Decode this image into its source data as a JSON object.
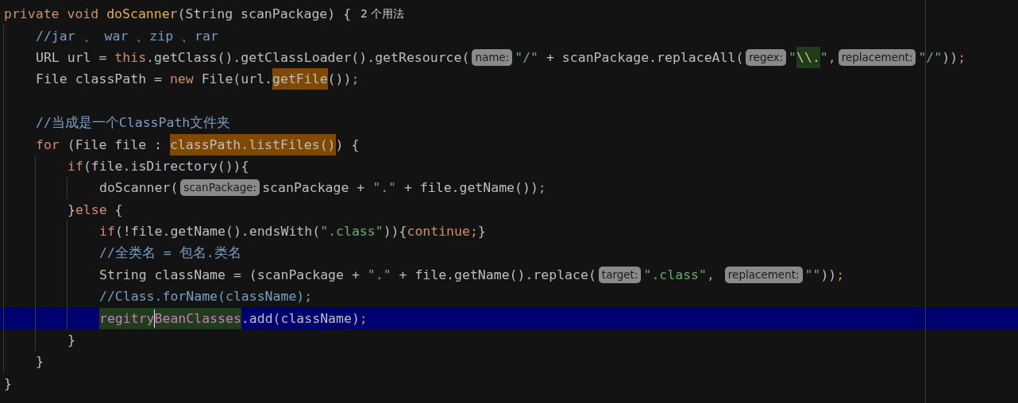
{
  "editor": {
    "lines": [
      {
        "current": false,
        "tokens": [
          {
            "kind": "keyword",
            "text": "private void "
          },
          {
            "kind": "declaration",
            "text": "doScanner"
          },
          {
            "kind": "plain",
            "text": "(String scanPackage) {"
          },
          {
            "kind": "usages",
            "text": "2 个用法"
          }
        ],
        "children": [
          {
            "current": false,
            "tokens": [
              {
                "kind": "comment",
                "text": "//jar 、 war 、zip 、rar"
              }
            ]
          },
          {
            "current": false,
            "tokens": [
              {
                "kind": "plain",
                "text": "URL url = "
              },
              {
                "kind": "keyword",
                "text": "this"
              },
              {
                "kind": "plain",
                "text": ".getClass().getClassLoader().getResource("
              },
              {
                "kind": "hint",
                "text": "name:"
              },
              {
                "kind": "string",
                "text": "\"/\""
              },
              {
                "kind": "plain",
                "text": " + scanPackage.replaceAll("
              },
              {
                "kind": "hint",
                "text": "regex:"
              },
              {
                "kind": "string",
                "text": "\""
              },
              {
                "kind": "escape",
                "text": "\\\\.",
                "write_highlight": true
              },
              {
                "kind": "string",
                "text": "\""
              },
              {
                "kind": "keyword",
                "text": ","
              },
              {
                "kind": "hint",
                "text": "replacement:"
              },
              {
                "kind": "string",
                "text": "\"/\""
              },
              {
                "kind": "plain",
                "text": "))"
              },
              {
                "kind": "keyword",
                "text": ";"
              }
            ]
          },
          {
            "current": false,
            "tokens": [
              {
                "kind": "plain",
                "text": "File classPath = "
              },
              {
                "kind": "keyword",
                "text": "new"
              },
              {
                "kind": "plain",
                "text": " File(url."
              },
              {
                "kind": "plain",
                "text": "getFile",
                "read_highlight": true
              },
              {
                "kind": "plain",
                "text": "())"
              },
              {
                "kind": "keyword",
                "text": ";"
              }
            ]
          },
          {
            "current": false
          },
          {
            "current": false,
            "tokens": [
              {
                "kind": "comment",
                "text": "//当成是一个ClassPath文件夹"
              }
            ]
          },
          {
            "current": false,
            "tokens": [
              {
                "kind": "keyword",
                "text": "for"
              },
              {
                "kind": "plain",
                "text": " (File file : "
              },
              {
                "kind": "plain",
                "text": "classPath.listFiles()",
                "read_highlight": true
              },
              {
                "kind": "plain",
                "text": ") {"
              }
            ],
            "children": [
              {
                "current": false,
                "tokens": [
                  {
                    "kind": "keyword",
                    "text": "if"
                  },
                  {
                    "kind": "plain",
                    "text": "(file.isDirectory()){"
                  }
                ],
                "children": [
                  {
                    "current": false,
                    "tokens": [
                      {
                        "kind": "plain",
                        "text": "doScanner("
                      },
                      {
                        "kind": "hint",
                        "text": "scanPackage:"
                      },
                      {
                        "kind": "plain",
                        "text": "scanPackage + "
                      },
                      {
                        "kind": "string",
                        "text": "\".\""
                      },
                      {
                        "kind": "plain",
                        "text": " + file.getName())"
                      },
                      {
                        "kind": "keyword",
                        "text": ";"
                      }
                    ]
                  }
                ]
              },
              {
                "current": false,
                "tokens": [
                  {
                    "kind": "plain",
                    "text": "}"
                  },
                  {
                    "kind": "keyword",
                    "text": "else"
                  },
                  {
                    "kind": "plain",
                    "text": " {"
                  }
                ],
                "children": [
                  {
                    "current": false,
                    "tokens": [
                      {
                        "kind": "keyword",
                        "text": "if"
                      },
                      {
                        "kind": "plain",
                        "text": "(!file.getName().endsWith("
                      },
                      {
                        "kind": "string",
                        "text": "\".class\""
                      },
                      {
                        "kind": "plain",
                        "text": ")){"
                      },
                      {
                        "kind": "keyword",
                        "text": "continue;"
                      },
                      {
                        "kind": "plain",
                        "text": "}"
                      }
                    ]
                  },
                  {
                    "current": false,
                    "tokens": [
                      {
                        "kind": "comment",
                        "text": "//全类名 = 包名.类名"
                      }
                    ]
                  },
                  {
                    "current": false,
                    "tokens": [
                      {
                        "kind": "plain",
                        "text": "String className = (scanPackage + "
                      },
                      {
                        "kind": "string",
                        "text": "\".\""
                      },
                      {
                        "kind": "plain",
                        "text": " + file.getName().replace("
                      },
                      {
                        "kind": "hint",
                        "text": "target:"
                      },
                      {
                        "kind": "string",
                        "text": "\".class\""
                      },
                      {
                        "kind": "keyword",
                        "text": ", "
                      },
                      {
                        "kind": "hint",
                        "text": "replacement:"
                      },
                      {
                        "kind": "string",
                        "text": "\"\""
                      },
                      {
                        "kind": "plain",
                        "text": "))"
                      },
                      {
                        "kind": "keyword",
                        "text": ";"
                      }
                    ]
                  },
                  {
                    "current": false,
                    "tokens": [
                      {
                        "kind": "comment",
                        "text": "//Class.forName(className);"
                      }
                    ]
                  },
                  {
                    "current": true,
                    "tokens": [
                      {
                        "kind": "field",
                        "text": "regitry",
                        "write_highlight": true,
                        "caret": true
                      },
                      {
                        "kind": "field",
                        "text": "BeanClasses",
                        "write_highlight": true
                      },
                      {
                        "kind": "plain",
                        "text": ".add(className)"
                      },
                      {
                        "kind": "keyword",
                        "text": ";"
                      }
                    ]
                  }
                ]
              },
              {
                "current": false,
                "tokens": [
                  {
                    "kind": "plain",
                    "text": "}"
                  }
                ]
              }
            ]
          },
          {
            "current": false,
            "tokens": [
              {
                "kind": "plain",
                "text": "}"
              }
            ]
          }
        ]
      },
      {
        "current": false,
        "tokens": [
          {
            "kind": "plain",
            "text": "}"
          }
        ]
      }
    ]
  }
}
